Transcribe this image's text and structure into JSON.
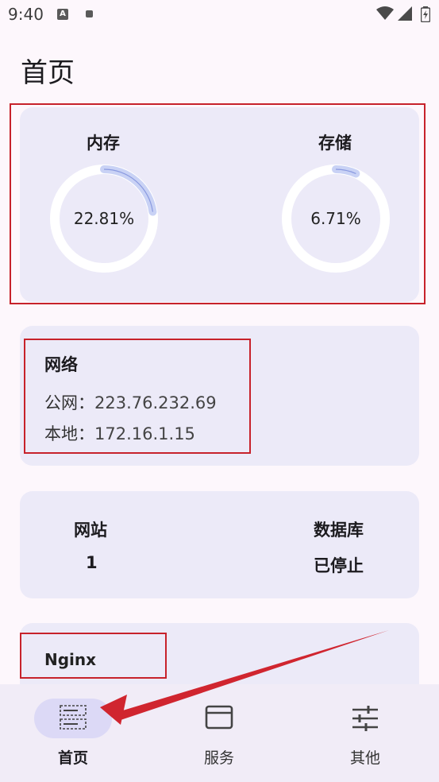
{
  "status_bar": {
    "time": "9:40",
    "app_badge": "A"
  },
  "page": {
    "title": "首页"
  },
  "usage": {
    "memory": {
      "label": "内存",
      "value": "22.81%",
      "percent": 22.81
    },
    "storage": {
      "label": "存储",
      "value": "6.71%",
      "percent": 6.71
    }
  },
  "network": {
    "title": "网络",
    "public_label": "公网：",
    "public_ip": "223.76.232.69",
    "local_label": "本地：",
    "local_ip": "172.16.1.15"
  },
  "stats": {
    "sites_label": "网站",
    "sites_value": "1",
    "database_label": "数据库",
    "database_value": "已停止"
  },
  "nginx": {
    "title": "Nginx"
  },
  "bottom_nav": {
    "home": "首页",
    "services": "服务",
    "other": "其他"
  },
  "colors": {
    "card_bg": "#eceaf8",
    "annotation_red": "#c7222b",
    "ring_track": "#ffffff",
    "ring_fill": "#aab8f0"
  }
}
